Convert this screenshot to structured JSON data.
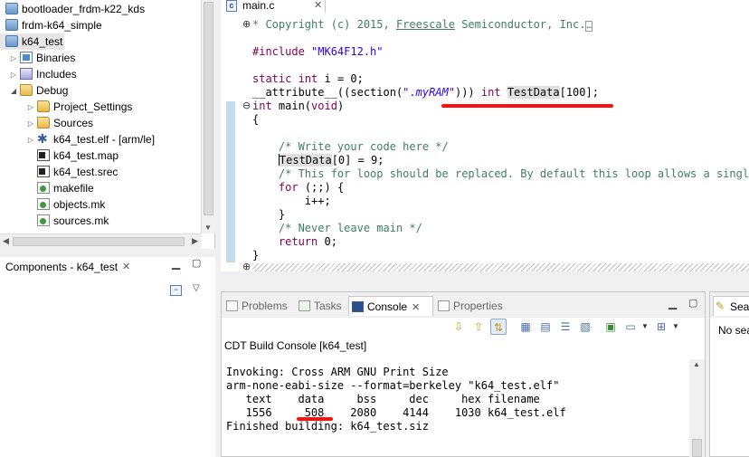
{
  "project_explorer": {
    "items": [
      {
        "label": "bootloader_frdm-k22_kds",
        "icon": "project-icon"
      },
      {
        "label": "frdm-k64_simple",
        "icon": "project-icon"
      },
      {
        "label": "k64_test",
        "icon": "project-icon"
      },
      {
        "label": "Binaries",
        "icon": "binaries-icon"
      },
      {
        "label": "Includes",
        "icon": "includes-icon"
      },
      {
        "label": "Debug",
        "icon": "folder-icon"
      },
      {
        "label": "Project_Settings",
        "icon": "folder-icon"
      },
      {
        "label": "Sources",
        "icon": "folder-icon"
      },
      {
        "label": "k64_test.elf - [arm/le]",
        "icon": "elf-icon"
      },
      {
        "label": "k64_test.map",
        "icon": "file-icon"
      },
      {
        "label": "k64_test.srec",
        "icon": "file-icon"
      },
      {
        "label": "makefile",
        "icon": "makefile-icon"
      },
      {
        "label": "objects.mk",
        "icon": "makefile-icon"
      },
      {
        "label": "sources.mk",
        "icon": "makefile-icon"
      }
    ]
  },
  "components": {
    "title": "Components - k64_test"
  },
  "editor": {
    "tab_label": "main.c",
    "lines": {
      "l1_pre": "* Copyright (c) 2015, ",
      "l1_link": "Freescale",
      "l1_post": " Semiconductor, Inc.",
      "l1_more": "…",
      "l3_dir": "#include",
      "l3_str": "\"MK64F12.h\"",
      "l5_kw1": "static",
      "l5_kw2": "int",
      "l5_rest": " i = 0;",
      "l6_pre": "__attribute__((section(",
      "l6_str1": "\".",
      "l6_str2": "myRAM",
      "l6_str3": "\"",
      "l6_mid": "))) ",
      "l6_kw": "int",
      "l6_var": "TestData",
      "l6_post": "[100];",
      "l7_kw": "int",
      "l7_name": " main(",
      "l7_kw2": "void",
      "l7_end": ")",
      "l8": "{",
      "l10": "/* Write your code here */",
      "l11_var": "TestData",
      "l11_rest": "[0] = 9;",
      "l12": "/* This for loop should be replaced. By default this loop allows a single s",
      "l13_kw": "for",
      "l13_rest": " (;;) {",
      "l14": "i++;",
      "l15": "}",
      "l16": "/* Never leave main */",
      "l17_kw": "return",
      "l17_rest": " 0;",
      "l18": "}"
    }
  },
  "console": {
    "tabs": [
      {
        "label": "Problems"
      },
      {
        "label": "Tasks"
      },
      {
        "label": "Console"
      },
      {
        "label": "Properties"
      }
    ],
    "console_name": "CDT Build Console [k64_test]",
    "output": [
      "Invoking: Cross ARM GNU Print Size",
      "arm-none-eabi-size --format=berkeley \"k64_test.elf\"",
      "   text    data     bss     dec     hex filename",
      "   1556     508    2080    4144    1030 k64_test.elf",
      "Finished building: k64_test.siz"
    ]
  },
  "search": {
    "tab_label": "Sea",
    "message": "No sea"
  },
  "colors": {
    "keyword": "#7f0055",
    "comment": "#3f7f5f",
    "string": "#2a00ff",
    "annotation_red": "#ff1010"
  }
}
